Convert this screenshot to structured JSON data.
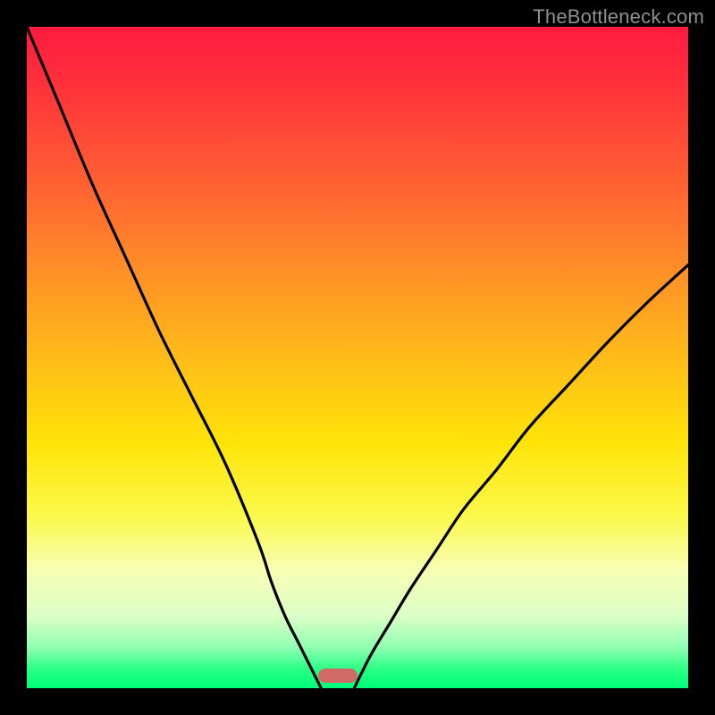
{
  "watermark": "TheBottleneck.com",
  "colors": {
    "frame": "#000000",
    "curve": "#000000",
    "marker": "#cf6a66",
    "gradient_top": "#ff1a3f",
    "gradient_mid": "#ffe408",
    "gradient_bottom": "#00ff7a"
  },
  "chart_data": {
    "type": "line",
    "title": "",
    "xlabel": "",
    "ylabel": "",
    "xlim": [
      0,
      100
    ],
    "ylim": [
      0,
      100
    ],
    "grid": false,
    "legend": false,
    "series": [
      {
        "name": "left-curve",
        "x": [
          0,
          5,
          10,
          15,
          20,
          25,
          30,
          35,
          37,
          39,
          41,
          43,
          44.5
        ],
        "y": [
          100,
          88,
          76,
          65,
          54,
          44,
          34,
          22,
          16,
          11,
          7,
          3,
          0
        ]
      },
      {
        "name": "right-curve",
        "x": [
          49.5,
          52,
          55,
          58,
          62,
          66,
          71,
          76,
          82,
          88,
          94,
          100
        ],
        "y": [
          0,
          5,
          10,
          15,
          21,
          27,
          33,
          39.5,
          46,
          52.5,
          58.5,
          64
        ]
      }
    ],
    "marker": {
      "x_start": 44,
      "x_end": 50,
      "y": 0.8,
      "height": 2.2
    }
  }
}
